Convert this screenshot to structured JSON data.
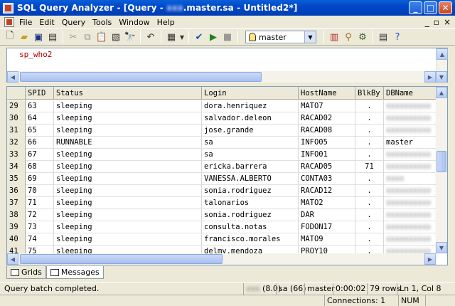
{
  "window": {
    "title_prefix": "SQL Query Analyzer - [Query - ",
    "title_host_redacted": "xxx",
    "title_suffix": ".master.sa - Untitled2*]"
  },
  "menu": [
    "File",
    "Edit",
    "Query",
    "Tools",
    "Window",
    "Help"
  ],
  "toolbar": {
    "database_selected": "master",
    "icons": [
      "new-query-icon",
      "open-icon",
      "save-icon",
      "load-script-icon",
      "cut-icon",
      "copy-icon",
      "paste-icon",
      "clear-icon",
      "find-icon",
      "undo-icon",
      "results-grid-icon",
      "parse-check-icon",
      "execute-icon",
      "stop-icon",
      "database-icon",
      "object-browser-icon",
      "object-search-icon",
      "execution-plan-icon",
      "properties-icon",
      "help-icon"
    ]
  },
  "editor": {
    "query": "sp_who2"
  },
  "grid": {
    "columns": [
      "SPID",
      "Status",
      "Login",
      "HostName",
      "BlkBy",
      "DBName"
    ],
    "rows": [
      {
        "row": "29",
        "spid": "63",
        "status": "sleeping",
        "login": "dora.henriquez",
        "host": "MATO7",
        "blkby": ".",
        "db": "xxxxxxxxxx",
        "db_redacted": true
      },
      {
        "row": "30",
        "spid": "64",
        "status": "sleeping",
        "login": "salvador.deleon",
        "host": "RACAD02",
        "blkby": ".",
        "db": "xxxxxxxxxx",
        "db_redacted": true
      },
      {
        "row": "31",
        "spid": "65",
        "status": "sleeping",
        "login": "jose.grande",
        "host": "RACAD08",
        "blkby": ".",
        "db": "xxxxxxxxxx",
        "db_redacted": true
      },
      {
        "row": "32",
        "spid": "66",
        "status": "RUNNABLE",
        "login": "sa",
        "host": "INFO05",
        "blkby": ".",
        "db": "master",
        "db_redacted": false
      },
      {
        "row": "33",
        "spid": "67",
        "status": "sleeping",
        "login": "sa",
        "host": "INFO01",
        "blkby": ".",
        "db": "xxxxxxxxxx",
        "db_redacted": true
      },
      {
        "row": "34",
        "spid": "68",
        "status": "sleeping",
        "login": "ericka.barrera",
        "host": "RACAD05",
        "blkby": "71",
        "db": "xxxxxxxxxx",
        "db_redacted": true
      },
      {
        "row": "35",
        "spid": "69",
        "status": "sleeping",
        "login": "VANESSA.ALBERTO",
        "host": "CONTA03",
        "blkby": ".",
        "db": "xxxx",
        "db_redacted": true
      },
      {
        "row": "36",
        "spid": "70",
        "status": "sleeping",
        "login": "sonia.rodriguez",
        "host": "RACAD12",
        "blkby": ".",
        "db": "xxxxxxxxxx",
        "db_redacted": true
      },
      {
        "row": "37",
        "spid": "71",
        "status": "sleeping",
        "login": "talonarios",
        "host": "MATO2",
        "blkby": ".",
        "db": "xxxxxxxxxx",
        "db_redacted": true
      },
      {
        "row": "38",
        "spid": "72",
        "status": "sleeping",
        "login": "sonia.rodriguez",
        "host": "DAR",
        "blkby": ".",
        "db": "xxxxxxxxxx",
        "db_redacted": true
      },
      {
        "row": "39",
        "spid": "73",
        "status": "sleeping",
        "login": "consulta.notas",
        "host": "FODON17",
        "blkby": ".",
        "db": "xxxxxxxxxx",
        "db_redacted": true
      },
      {
        "row": "40",
        "spid": "74",
        "status": "sleeping",
        "login": "francisco.morales",
        "host": "MATO9",
        "blkby": ".",
        "db": "xxxxxxxxxx",
        "db_redacted": true
      },
      {
        "row": "41",
        "spid": "75",
        "status": "sleeping",
        "login": "delmy.mendoza",
        "host": "PROY10",
        "blkby": ".",
        "db": "xxxxxxxxxx",
        "db_redacted": true
      }
    ]
  },
  "tabs": [
    {
      "label": "Grids",
      "active": false
    },
    {
      "label": "Messages",
      "active": true
    }
  ],
  "status": {
    "message": "Query batch completed.",
    "server_redacted": "xxx",
    "server_version": "(8.0)",
    "user": "sa (66)",
    "database": "master",
    "elapsed": "0:00:02",
    "rows": "79 rows",
    "position": "Ln 1, Col 8"
  },
  "app_status": {
    "connections": "Connections: 1",
    "num": "NUM"
  },
  "colors": {
    "titlebar": "#0048c8",
    "keyword_red": "#b40000",
    "chrome": "#ece9d8"
  }
}
